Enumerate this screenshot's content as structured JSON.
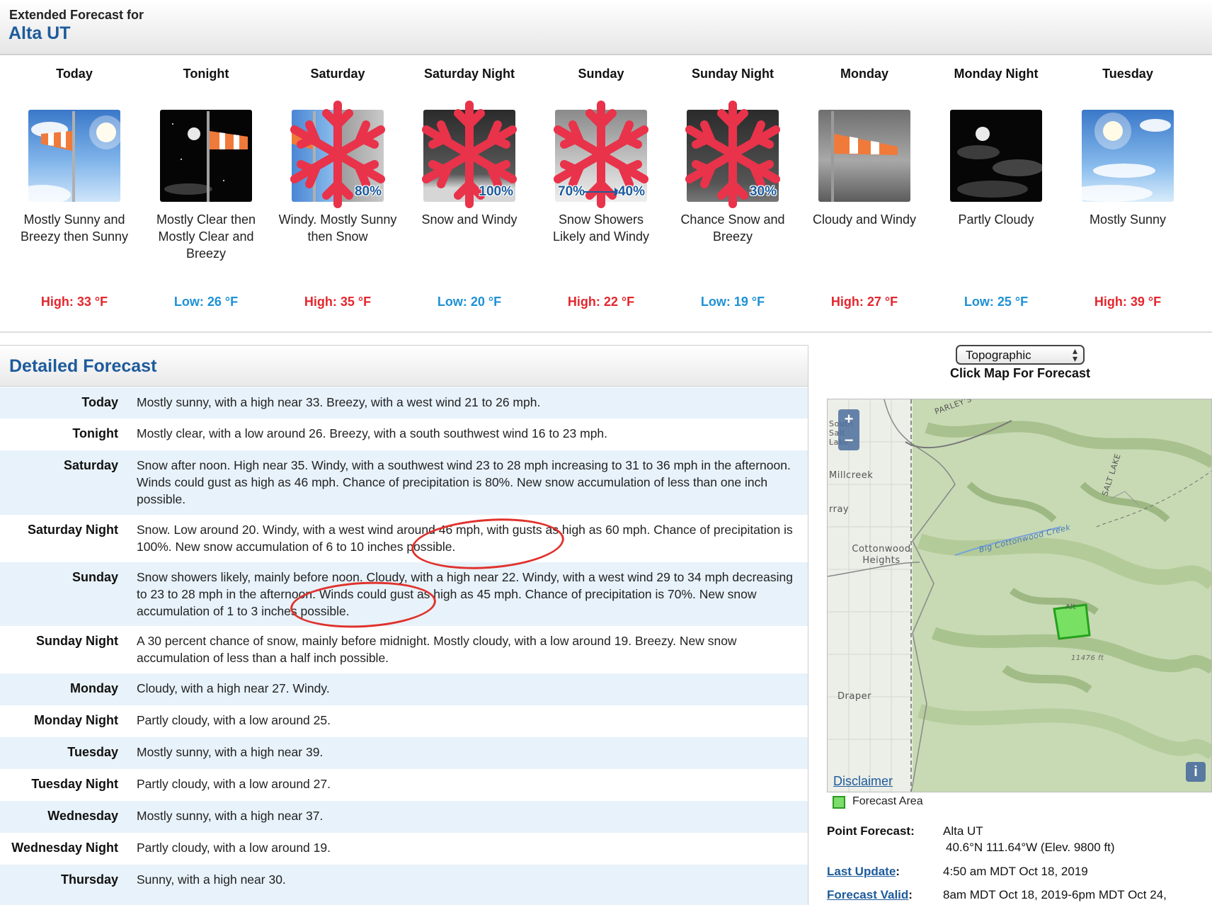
{
  "header": {
    "label": "Extended Forecast for",
    "location": "Alta UT"
  },
  "periods": [
    {
      "name": "Today",
      "icon": "windy-sunny-icon",
      "desc": "Mostly Sunny and Breezy then Sunny",
      "temp": "High: 33 °F",
      "kind": "hi"
    },
    {
      "name": "Tonight",
      "icon": "windy-night-moon-icon",
      "desc": "Mostly Clear then Mostly Clear and Breezy",
      "temp": "Low: 26 °F",
      "kind": "lo"
    },
    {
      "name": "Saturday",
      "icon": "windy-snow-icon",
      "pct": "80%",
      "desc": "Windy. Mostly Sunny then Snow",
      "temp": "High: 35 °F",
      "kind": "hi"
    },
    {
      "name": "Saturday Night",
      "icon": "snow-windy-icon",
      "pct": "100%",
      "desc": "Snow and Windy",
      "temp": "Low: 20 °F",
      "kind": "lo"
    },
    {
      "name": "Sunday",
      "icon": "snow-showers-icon",
      "pct_from": "70%",
      "pct": "40%",
      "desc": "Snow Showers Likely and Windy",
      "temp": "High: 22 °F",
      "kind": "hi"
    },
    {
      "name": "Sunday Night",
      "icon": "chance-snow-icon",
      "pct": "30%",
      "desc": "Chance Snow and Breezy",
      "temp": "Low: 19 °F",
      "kind": "lo"
    },
    {
      "name": "Monday",
      "icon": "cloudy-windy-icon",
      "desc": "Cloudy and Windy",
      "temp": "High: 27 °F",
      "kind": "hi"
    },
    {
      "name": "Monday Night",
      "icon": "partly-cloudy-night-icon",
      "desc": "Partly Cloudy",
      "temp": "Low: 25 °F",
      "kind": "lo"
    },
    {
      "name": "Tuesday",
      "icon": "mostly-sunny-icon",
      "desc": "Mostly Sunny",
      "temp": "High: 39 °F",
      "kind": "hi"
    }
  ],
  "detail": {
    "title": "Detailed Forecast",
    "rows": [
      {
        "label": "Today",
        "text": "Mostly sunny, with a high near 33. Breezy, with a west wind 21 to 26 mph."
      },
      {
        "label": "Tonight",
        "text": "Mostly clear, with a low around 26. Breezy, with a south southwest wind 16 to 23 mph."
      },
      {
        "label": "Saturday",
        "text": "Snow after noon. High near 35. Windy, with a southwest wind 23 to 28 mph increasing to 31 to 36 mph in the afternoon. Winds could gust as high as 46 mph. Chance of precipitation is 80%. New snow accumulation of less than one inch possible."
      },
      {
        "label": "Saturday Night",
        "text": "Snow. Low around 20. Windy, with a west wind around 46 mph, with gusts as high as 60 mph. Chance of precipitation is 100%. New snow accumulation of 6 to 10 inches possible."
      },
      {
        "label": "Sunday",
        "text": "Snow showers likely, mainly before noon. Cloudy, with a high near 22. Windy, with a west wind 29 to 34 mph decreasing to 23 to 28 mph in the afternoon. Winds could gust as high as 45 mph. Chance of precipitation is 70%. New snow accumulation of 1 to 3 inches possible."
      },
      {
        "label": "Sunday Night",
        "text": "A 30 percent chance of snow, mainly before midnight. Mostly cloudy, with a low around 19. Breezy. New snow accumulation of less than a half inch possible."
      },
      {
        "label": "Monday",
        "text": "Cloudy, with a high near 27. Windy."
      },
      {
        "label": "Monday Night",
        "text": "Partly cloudy, with a low around 25."
      },
      {
        "label": "Tuesday",
        "text": "Mostly sunny, with a high near 39."
      },
      {
        "label": "Tuesday Night",
        "text": "Partly cloudy, with a low around 27."
      },
      {
        "label": "Wednesday",
        "text": "Mostly sunny, with a high near 37."
      },
      {
        "label": "Wednesday Night",
        "text": "Partly cloudy, with a low around 19."
      },
      {
        "label": "Thursday",
        "text": "Sunny, with a high near 30."
      }
    ]
  },
  "map": {
    "select_value": "Topographic",
    "hint": "Click Map For Forecast",
    "zoom_in": "+",
    "zoom_out": "−",
    "info": "i",
    "disclaimer": "Disclaimer",
    "legend": "Forecast Area",
    "places": {
      "south_salt_lake": "South Salt Lake",
      "millcreek": "Millcreek",
      "murray": "rray",
      "cottonwood_heights": "Cottonwood Heights",
      "draper": "Draper",
      "big_cottonwood_creek": "Big Cottonwood Creek",
      "salt_lake": "SALT LAKE",
      "parleys": "PARLEY'S",
      "alta": "Alt",
      "peak": "11476 ft"
    }
  },
  "point": {
    "label": "Point Forecast:",
    "name": "Alta UT",
    "coords": "40.6°N 111.64°W (Elev. 9800 ft)",
    "update_label": "Last Update",
    "update_value": "4:50 am MDT Oct 18, 2019",
    "valid_label": "Forecast Valid",
    "valid_value": "8am MDT Oct 18, 2019-6pm MDT Oct 24,"
  },
  "colors": {
    "accent": "#1d5b9c",
    "high": "#e3262d",
    "low": "#1e91d6",
    "row_alt": "#e8f2fa",
    "annotation": "#e0322d"
  }
}
